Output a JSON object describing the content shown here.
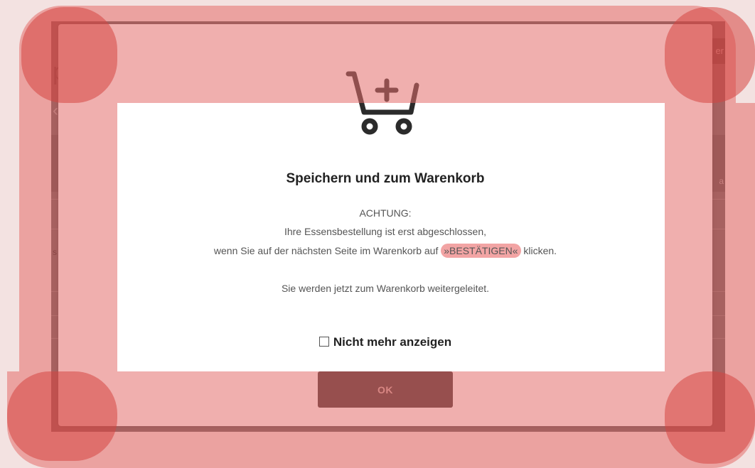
{
  "background": {
    "title_fragment": "p",
    "back_fragment": "‹",
    "tab_fragment": "er",
    "side_label_fragment": "s",
    "side_right_fragment": "a"
  },
  "modal": {
    "icon": "cart-plus-icon",
    "title": "Speichern und zum Warenkorb",
    "message": {
      "heading": "ACHTUNG:",
      "line1": "Ihre Essensbestellung ist erst abgeschlossen,",
      "line2_before": "wenn Sie auf der nächsten Seite im Warenkorb auf ",
      "line2_highlight": "»BESTÄTIGEN«",
      "line2_after": " klicken.",
      "redirect": "Sie werden jetzt zum Warenkorb weitergeleitet."
    },
    "checkbox": {
      "label": "Nicht mehr anzeigen",
      "checked": false
    },
    "ok_label": "OK"
  },
  "colors": {
    "overlay_band": "#e46e6b",
    "ok_button_bg": "#3a2b2b",
    "ok_button_text": "#c9a59f",
    "highlight": "#f2a4a4"
  }
}
